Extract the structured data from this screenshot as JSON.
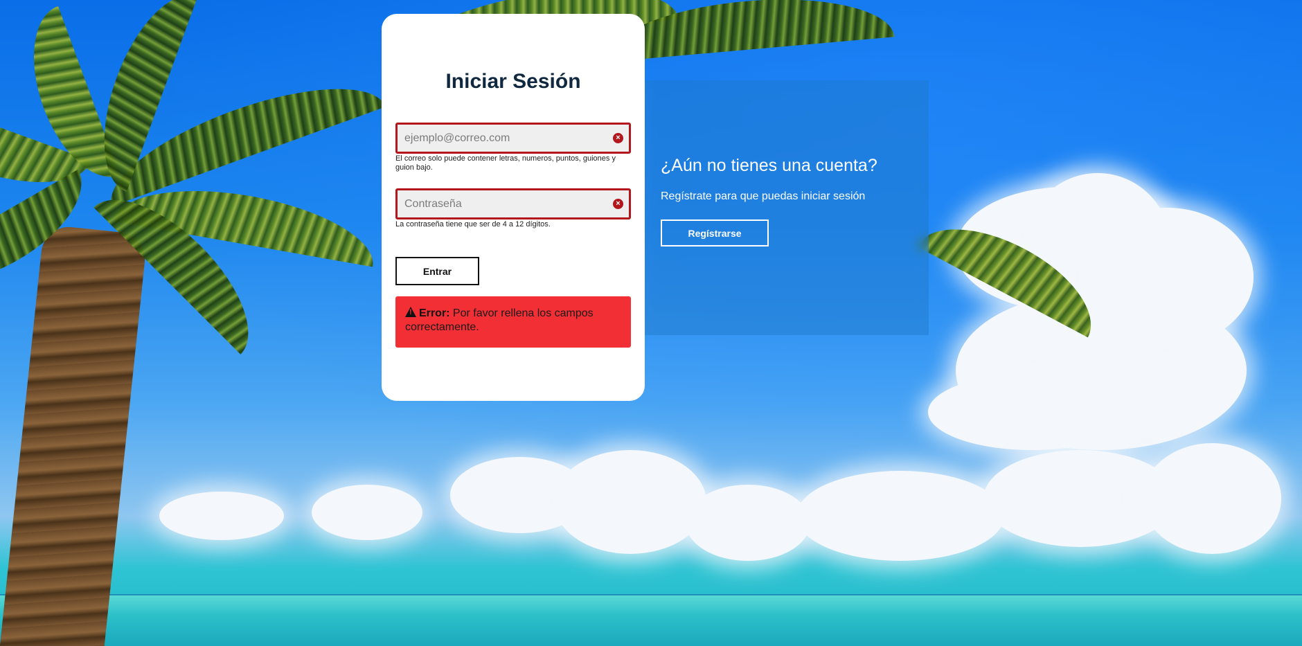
{
  "login": {
    "title": "Iniciar Sesión",
    "email_placeholder": "ejemplo@correo.com",
    "email_value": "",
    "email_hint": "El correo solo puede contener letras, numeros, puntos, guiones y guion bajo.",
    "password_placeholder": "Contraseña",
    "password_value": "",
    "password_hint": "La contraseña tiene que ser de 4 a 12 dígitos.",
    "submit_label": "Entrar",
    "error_label": "Error:",
    "error_message": "Por favor rellena los campos correctamente.",
    "field_error_icon": "×"
  },
  "register": {
    "heading": "¿Aún no tienes una cuenta?",
    "text": "Regístrate para que puedas iniciar sesión",
    "button_label": "Regístrarse"
  },
  "icons": {
    "field_error": "times-circle-icon",
    "error": "warning-triangle-icon"
  },
  "colors": {
    "error_border": "#b4161e",
    "error_background": "#f22f34",
    "title_text": "#10283f"
  }
}
